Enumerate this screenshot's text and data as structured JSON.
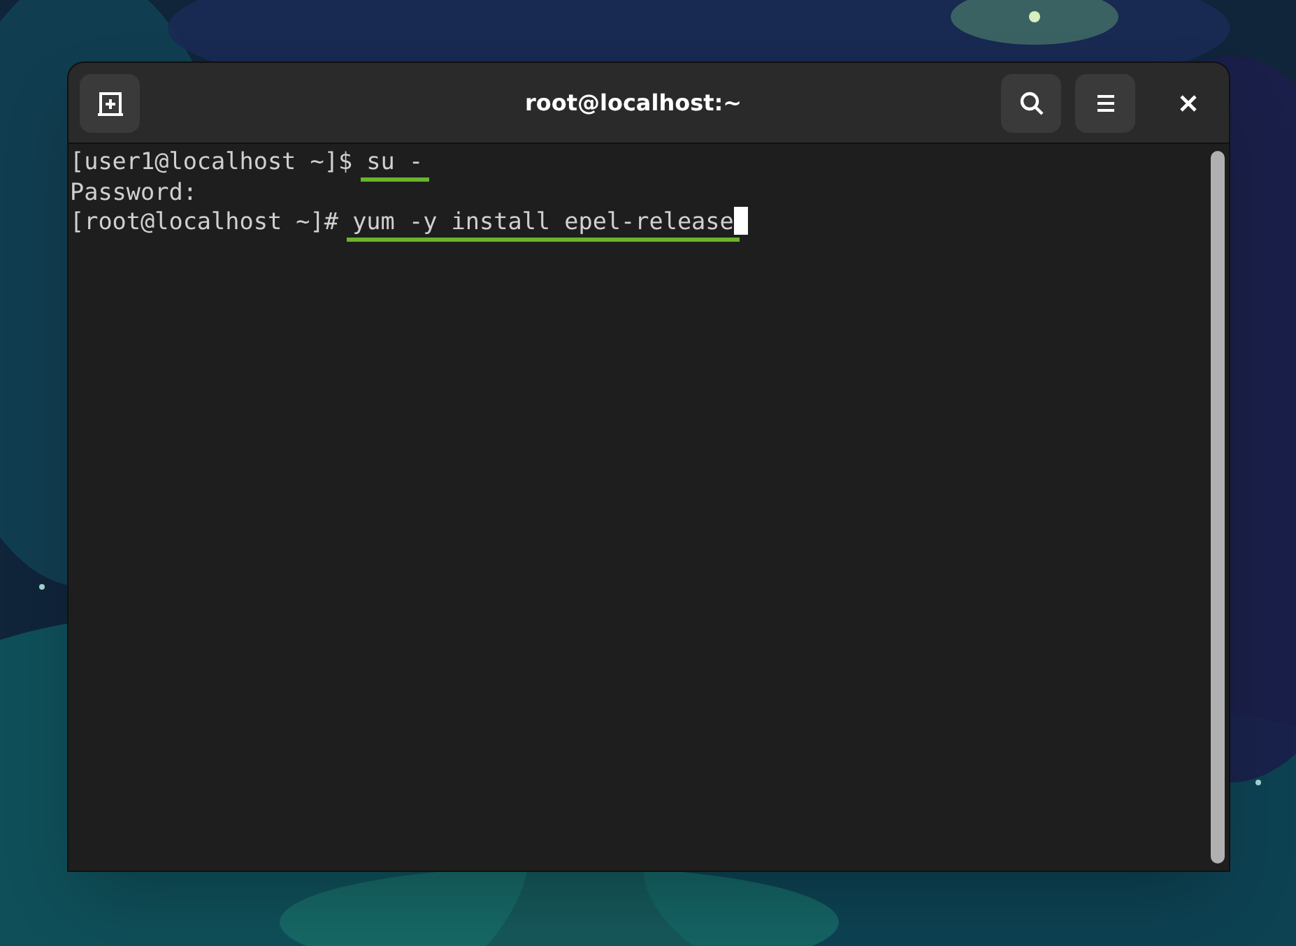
{
  "window": {
    "title": "root@localhost:~"
  },
  "terminal": {
    "lines": [
      {
        "prompt": "[user1@localhost ~]$ ",
        "command": "su -",
        "underlined": true,
        "cursor": false
      },
      {
        "prompt": "Password:",
        "underlined": false,
        "cursor": false
      },
      {
        "prompt": "[root@localhost ~]# ",
        "command": "yum -y install epel-release",
        "underlined": true,
        "cursor": true
      }
    ]
  }
}
